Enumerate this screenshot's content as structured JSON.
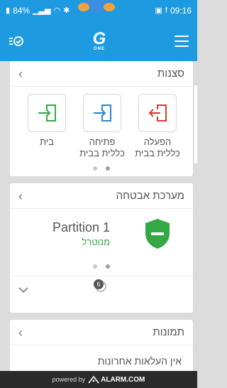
{
  "status_bar": {
    "battery": "84%",
    "time": "09:16"
  },
  "colors": {
    "primary": "#1e9be0",
    "scene_green": "#34a845",
    "scene_blue": "#2f86c8",
    "scene_red": "#d43a2f",
    "shield_green": "#34a845"
  },
  "app_bar": {
    "logo_text": "G",
    "logo_sub": "ONE",
    "left_icon": "history-check-icon",
    "right_icon": "hamburger-menu-icon"
  },
  "scenes": {
    "title": "סצנות",
    "items": [
      {
        "label": "בית",
        "icon": "door-enter-icon",
        "color": "#34a845"
      },
      {
        "label": "פתיחה כללית בבית",
        "icon": "door-enter-icon",
        "color": "#2f86c8"
      },
      {
        "label": "הפעלה כללית בבית",
        "icon": "door-exit-icon",
        "color": "#d43a2f"
      }
    ],
    "page_count": 2,
    "active_page": 2
  },
  "security": {
    "title": "מערכת אבטחה",
    "partition_name": "Partition 1",
    "partition_status": "מנוטרל",
    "page_count": 2,
    "active_page": 2,
    "badge_count": "6"
  },
  "images": {
    "title": "תמונות",
    "empty_text": "אין העלאות אחרונות"
  },
  "footer": {
    "powered_by": "powered by",
    "brand": "ALARM.COM"
  }
}
